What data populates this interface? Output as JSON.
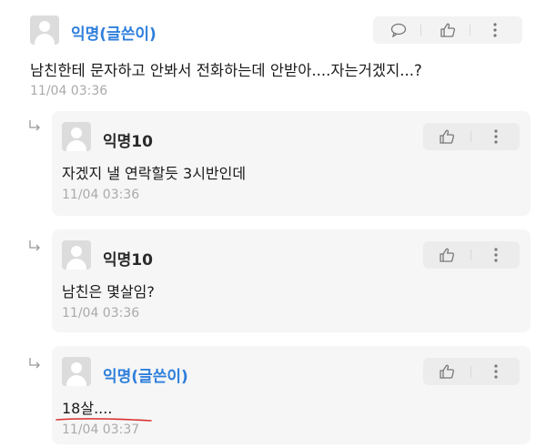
{
  "post": {
    "author": "익명(글쓴이)",
    "content": "남친한테 문자하고 안봐서 전화하는데 안받아....자는거겠지...?",
    "time": "11/04 03:36",
    "icons": [
      "speech-bubble-icon",
      "thumbs-up-icon",
      "more-vertical-icon"
    ]
  },
  "replies": [
    {
      "author": "익명10",
      "content": "자겠지 낼 연락할듯 3시반인데",
      "time": "11/04 03:36"
    },
    {
      "author": "익명10",
      "content": "남친은 몇살임?",
      "time": "11/04 03:36"
    },
    {
      "author": "익명(글쓴이)",
      "content": "18살....",
      "time": "11/04 03:37"
    }
  ],
  "colors": {
    "op_author": "#2f7fdc",
    "time": "#aaaaaa",
    "card_bg": "#f6f6f6",
    "underline": "#d9302f"
  }
}
